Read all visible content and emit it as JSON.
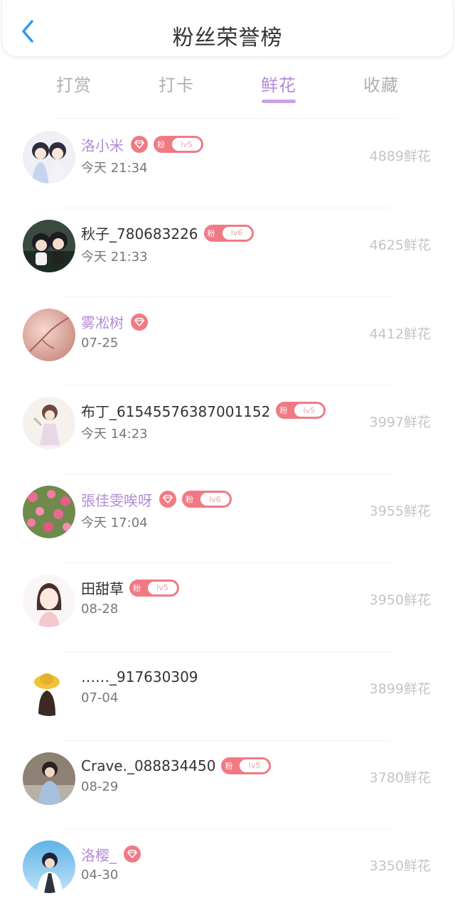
{
  "header": {
    "title": "粉丝荣誉榜"
  },
  "tabs": [
    {
      "label": "打赏",
      "active": false
    },
    {
      "label": "打卡",
      "active": false
    },
    {
      "label": "鲜花",
      "active": true
    },
    {
      "label": "收藏",
      "active": false
    }
  ],
  "colors": {
    "accent": "#b58ad6",
    "badge": "#f07a84",
    "muted_score": "#c4c4c4"
  },
  "fans": [
    {
      "name": "洛小米",
      "vip": true,
      "diamond": true,
      "fan_badge": {
        "char": "粉",
        "level": "lv5"
      },
      "time": "今天 21:34",
      "score": "4889鲜花",
      "avatar": "anime-couple-avatar"
    },
    {
      "name": "秋子_780683226",
      "vip": false,
      "diamond": false,
      "fan_badge": {
        "char": "粉",
        "level": "lv6"
      },
      "time": "今天 21:33",
      "score": "4625鲜花",
      "avatar": "chibi-figures-avatar"
    },
    {
      "name": "雾凇树",
      "vip": true,
      "diamond": true,
      "fan_badge": null,
      "time": "07-25",
      "score": "4412鲜花",
      "avatar": "pink-blossom-avatar"
    },
    {
      "name": "布丁_61545576387001152",
      "vip": false,
      "diamond": false,
      "fan_badge": {
        "char": "粉",
        "level": "lv5"
      },
      "time": "今天 14:23",
      "score": "3997鲜花",
      "avatar": "girl-illustration-avatar"
    },
    {
      "name": "張佳雯唉呀",
      "vip": true,
      "diamond": true,
      "fan_badge": {
        "char": "粉",
        "level": "lv6"
      },
      "time": "今天 17:04",
      "score": "3955鲜花",
      "avatar": "flower-field-avatar"
    },
    {
      "name": "田甜草",
      "vip": false,
      "diamond": false,
      "fan_badge": {
        "char": "粉",
        "level": "lv5"
      },
      "time": "08-28",
      "score": "3950鲜花",
      "avatar": "anime-girl-avatar"
    },
    {
      "name": "……_917630309",
      "vip": false,
      "diamond": false,
      "fan_badge": null,
      "time": "07-04",
      "score": "3899鲜花",
      "avatar": "yellow-hat-avatar"
    },
    {
      "name": "Crave._088834450",
      "vip": false,
      "diamond": false,
      "fan_badge": {
        "char": "粉",
        "level": "lv5"
      },
      "time": "08-29",
      "score": "3780鲜花",
      "avatar": "photo-girl-avatar"
    },
    {
      "name": "洛樱_",
      "vip": true,
      "diamond": true,
      "fan_badge": null,
      "time": "04-30",
      "score": "3350鲜花",
      "avatar": "blue-sky-avatar"
    }
  ]
}
